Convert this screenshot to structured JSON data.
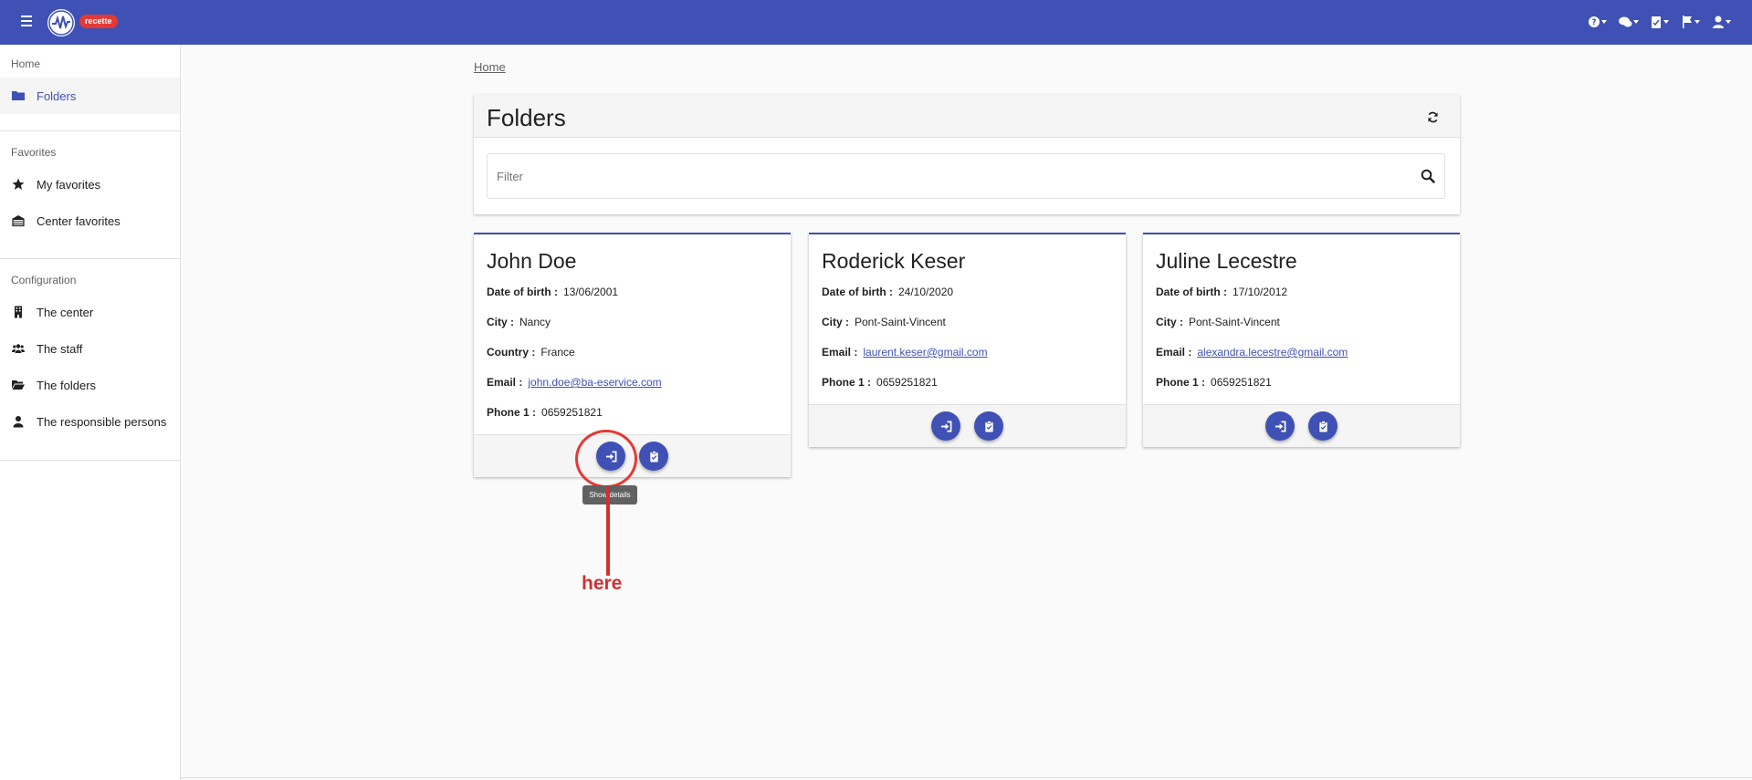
{
  "app": {
    "env_badge": "recette"
  },
  "sidebar": {
    "home_title": "Home",
    "home_items": [
      {
        "label": "Folders",
        "icon": "folder-icon"
      }
    ],
    "favorites_title": "Favorites",
    "favorites_items": [
      {
        "label": "My favorites",
        "icon": "star-icon"
      },
      {
        "label": "Center favorites",
        "icon": "building-icon"
      }
    ],
    "config_title": "Configuration",
    "config_items": [
      {
        "label": "The center",
        "icon": "office-icon"
      },
      {
        "label": "The staff",
        "icon": "users-icon"
      },
      {
        "label": "The folders",
        "icon": "folder-open-icon"
      },
      {
        "label": "The responsible persons",
        "icon": "person-icon"
      }
    ]
  },
  "breadcrumb": {
    "home": "Home"
  },
  "panel": {
    "title": "Folders",
    "filter_placeholder": "Filter"
  },
  "labels": {
    "dob": "Date of birth :",
    "city": "City :",
    "country": "Country :",
    "email": "Email :",
    "phone": "Phone 1 :"
  },
  "cards": [
    {
      "name": "John Doe",
      "dob": "13/06/2001",
      "city": "Nancy",
      "country": "France",
      "email": "john.doe@ba-eservice.com",
      "phone": "0659251821"
    },
    {
      "name": "Roderick Keser",
      "dob": "24/10/2020",
      "city": "Pont-Saint-Vincent",
      "email": "laurent.keser@gmail.com",
      "phone": "0659251821"
    },
    {
      "name": "Juline Lecestre",
      "dob": "17/10/2012",
      "city": "Pont-Saint-Vincent",
      "email": "alexandra.lecestre@gmail.com",
      "phone": "0659251821"
    }
  ],
  "tooltip": "Show details",
  "annotation": "here",
  "colors": {
    "primary": "#3f51b5",
    "annotation": "#d32f2f",
    "badge": "#e53935"
  }
}
